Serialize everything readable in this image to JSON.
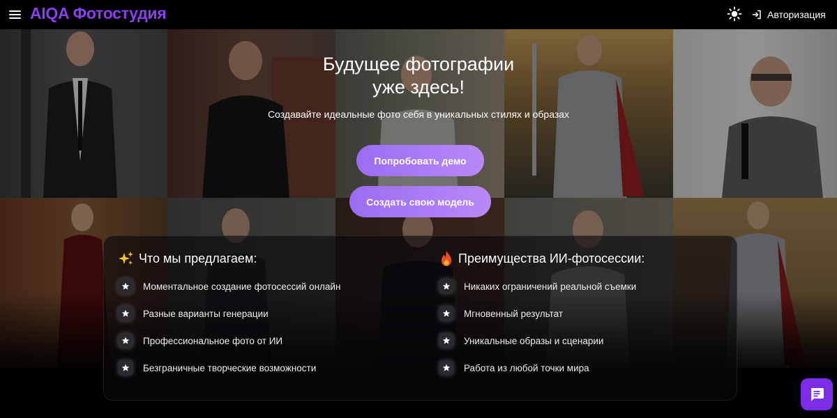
{
  "header": {
    "brand": "AIQA Фотостудия",
    "menu_icon": "hamburger-menu-icon",
    "theme_icon": "sun-icon",
    "login_icon": "login-icon",
    "login_label": "Авторизация"
  },
  "hero": {
    "title_line1": "Будущее фотографии",
    "title_line2": "уже здесь!",
    "subtitle": "Создавайте идеальные фото себя в уникальных стилях и образах",
    "demo_button": "Попробовать демо",
    "model_button": "Создать свою модель"
  },
  "features": {
    "offer": {
      "icon": "sparkles-icon",
      "title": "Что мы предлагаем:",
      "items": [
        "Моментальное создание фотосессий онлайн",
        "Разные варианты генерации",
        "Профессиональное фото от ИИ",
        "Безграничные творческие возможности"
      ]
    },
    "benefits": {
      "icon": "fire-icon",
      "title": "Преимущества ИИ-фотосессии:",
      "items": [
        "Никаких ограничений реальной съемки",
        "Мгновенный результат",
        "Уникальные образы и сценарии",
        "Работа из любой точки мира"
      ]
    }
  },
  "chat": {
    "icon": "chat-icon"
  },
  "colors": {
    "brand": "#8b3ff0",
    "button_start": "#9b6cf2",
    "button_end": "#b889f7",
    "chat_bg": "#7b2ce8"
  }
}
